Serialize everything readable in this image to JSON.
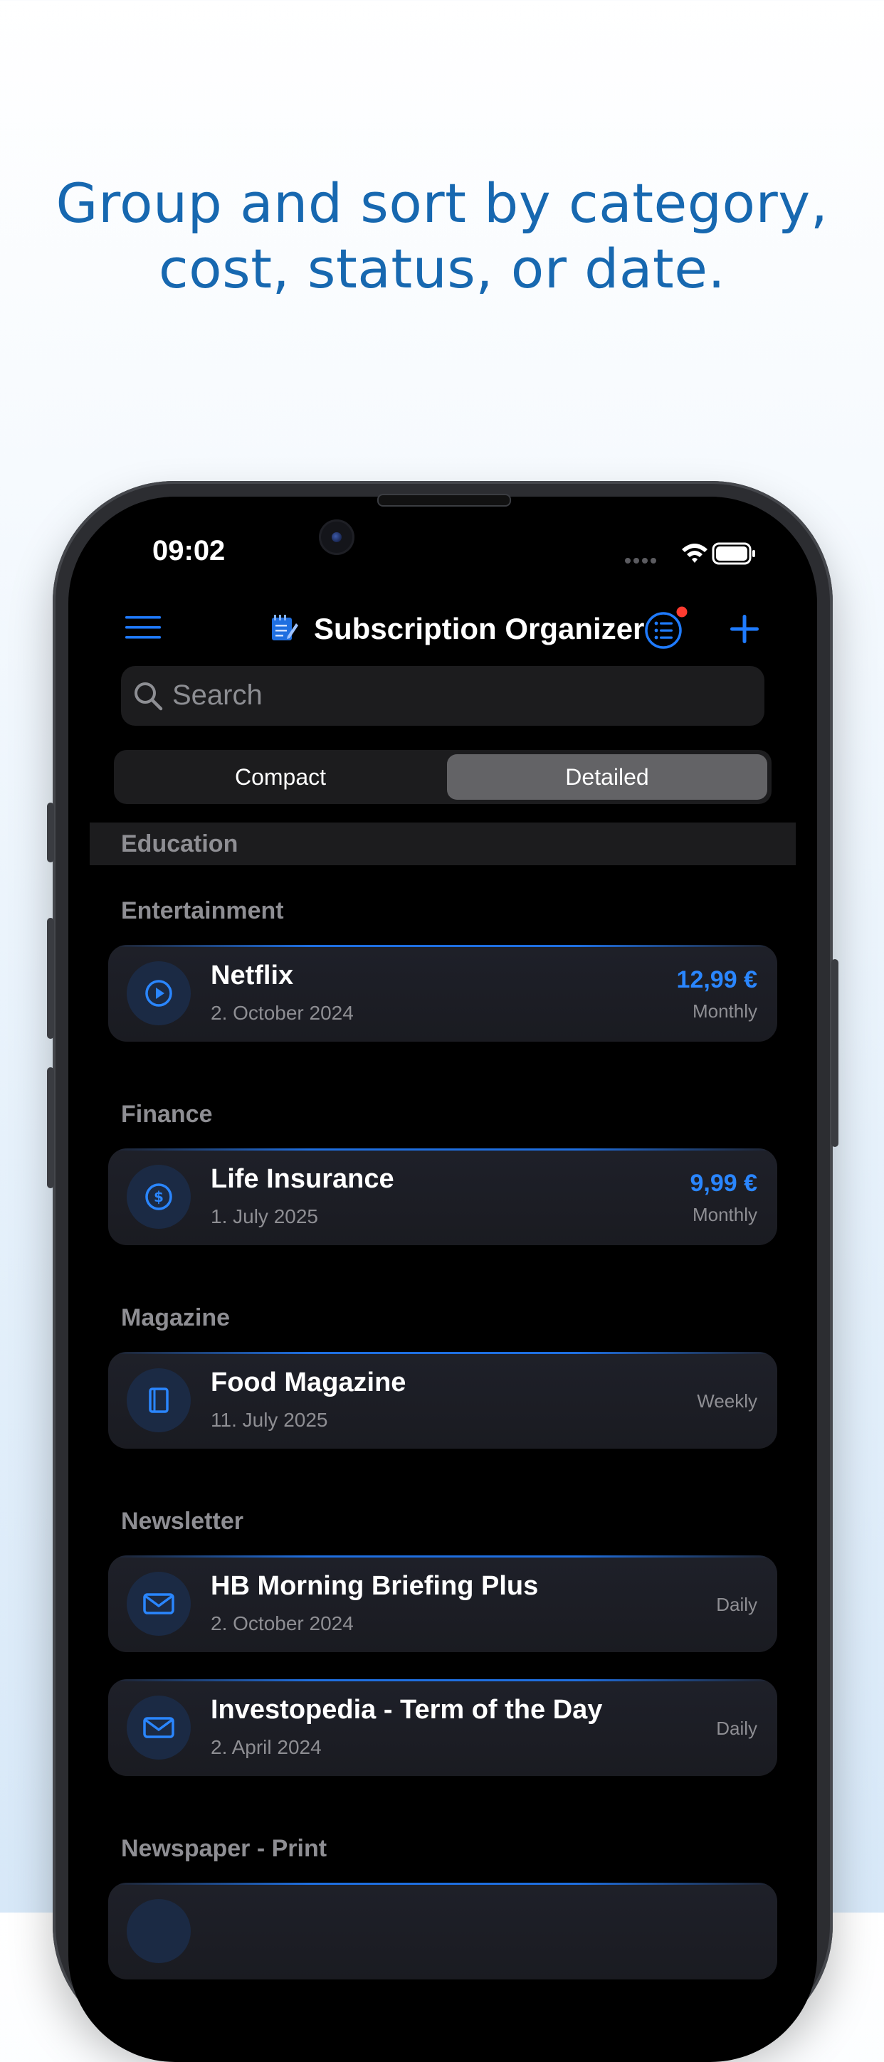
{
  "headline": {
    "line1": "Group and sort by category,",
    "line2": "cost, status, or date."
  },
  "status_bar": {
    "time": "09:02",
    "icons": [
      "signal-icon",
      "wifi-icon",
      "battery-icon"
    ]
  },
  "nav": {
    "title": "Subscription Organizer",
    "menu_icon": "menu-icon",
    "app_icon": "notepad-icon",
    "filter_icon": "list-icon",
    "add_icon": "plus-icon"
  },
  "search": {
    "placeholder": "Search"
  },
  "view_toggle": {
    "options": [
      "Compact",
      "Detailed"
    ],
    "selected": "Detailed"
  },
  "sections": [
    {
      "name": "Education",
      "items": []
    },
    {
      "name": "Entertainment",
      "items": [
        {
          "name": "Netflix",
          "date": "2. October 2024",
          "price": "12,99 €",
          "cycle": "Monthly",
          "icon": "play-icon"
        }
      ]
    },
    {
      "name": "Finance",
      "items": [
        {
          "name": "Life Insurance",
          "date": "1. July 2025",
          "price": "9,99 €",
          "cycle": "Monthly",
          "icon": "dollar-icon"
        }
      ]
    },
    {
      "name": "Magazine",
      "items": [
        {
          "name": "Food Magazine",
          "date": "11. July 2025",
          "price": "",
          "cycle": "Weekly",
          "icon": "book-icon"
        }
      ]
    },
    {
      "name": "Newsletter",
      "items": [
        {
          "name": "HB Morning Briefing Plus",
          "date": "2. October 2024",
          "price": "",
          "cycle": "Daily",
          "icon": "envelope-icon"
        },
        {
          "name": "Investopedia - Term of the Day",
          "date": "2. April 2024",
          "price": "",
          "cycle": "Daily",
          "icon": "envelope-icon"
        }
      ]
    },
    {
      "name": "Newspaper - Print",
      "items": []
    }
  ],
  "colors": {
    "accent": "#1F7BFF",
    "headline": "#1768B0",
    "background": "#000000",
    "card": "#1C1D23",
    "badge": "#FF3B30"
  }
}
